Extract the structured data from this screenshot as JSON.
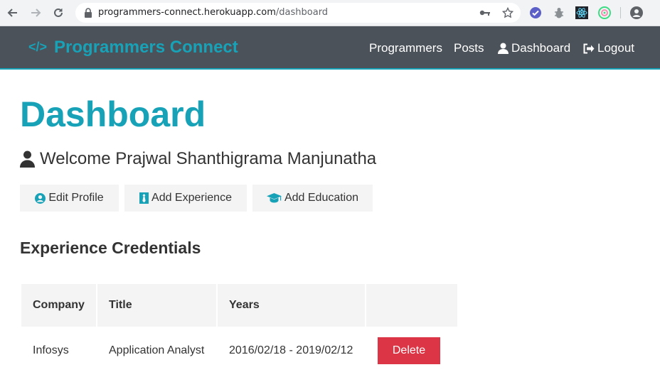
{
  "browser": {
    "url_host": "programmers-connect.herokuapp.com",
    "url_path": "/dashboard"
  },
  "navbar": {
    "brand": "Programmers Connect",
    "links": [
      {
        "label": "Programmers"
      },
      {
        "label": "Posts"
      },
      {
        "label": "Dashboard",
        "icon": "user-icon"
      },
      {
        "label": "Logout",
        "icon": "sign-out-icon"
      }
    ]
  },
  "colors": {
    "accent": "#17a2b8",
    "navbar_bg": "#4b5259",
    "danger": "#dc3545",
    "light_btn": "#f4f4f4"
  },
  "main": {
    "title": "Dashboard",
    "welcome": "Welcome Prajwal Shanthigrama Manjunatha",
    "actions": [
      {
        "label": "Edit Profile",
        "icon": "user-circle-icon"
      },
      {
        "label": "Add Experience",
        "icon": "black-tie-icon"
      },
      {
        "label": "Add Education",
        "icon": "graduation-cap-icon"
      }
    ],
    "experience": {
      "heading": "Experience Credentials",
      "columns": [
        "Company",
        "Title",
        "Years",
        ""
      ],
      "rows": [
        {
          "company": "Infosys",
          "title": "Application Analyst",
          "years": "2016/02/18 - 2019/02/12",
          "action": "Delete"
        }
      ]
    }
  }
}
